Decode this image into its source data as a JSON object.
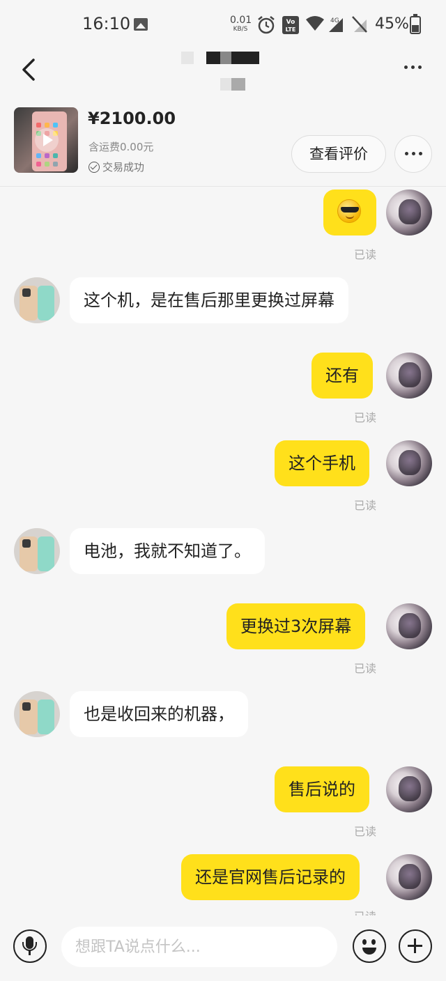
{
  "status_bar": {
    "time": "16:10",
    "net_speed_value": "0.01",
    "net_speed_unit": "KB/S",
    "volte_label": "Vo LTE",
    "signal_label": "4G",
    "battery_percent": "45%",
    "battery_level": 0.45
  },
  "product": {
    "price": "¥2100.00",
    "shipping": "含运费0.00元",
    "status": "交易成功",
    "review_label": "查看评价"
  },
  "messages": [
    {
      "from": "me",
      "type": "sticker",
      "icon": "sunglasses-emoji-icon",
      "read": "已读"
    },
    {
      "from": "other",
      "text": "这个机，是在售后那里更换过屏幕"
    },
    {
      "from": "me",
      "text": "还有",
      "read": "已读"
    },
    {
      "from": "me",
      "text": "这个手机",
      "read": "已读"
    },
    {
      "from": "other",
      "text": "电池，我就不知道了。"
    },
    {
      "from": "me",
      "text": "更换过3次屏幕",
      "read": "已读"
    },
    {
      "from": "other",
      "text": "也是收回来的机器，"
    },
    {
      "from": "me",
      "text": "售后说的",
      "read": "已读"
    },
    {
      "from": "me",
      "text": "还是官网售后记录的",
      "read": "已读"
    }
  ],
  "input": {
    "placeholder": "想跟TA说点什么..."
  },
  "colors": {
    "my_bubble": "#ffe01b",
    "other_bubble": "#ffffff",
    "background": "#f6f6f6"
  }
}
